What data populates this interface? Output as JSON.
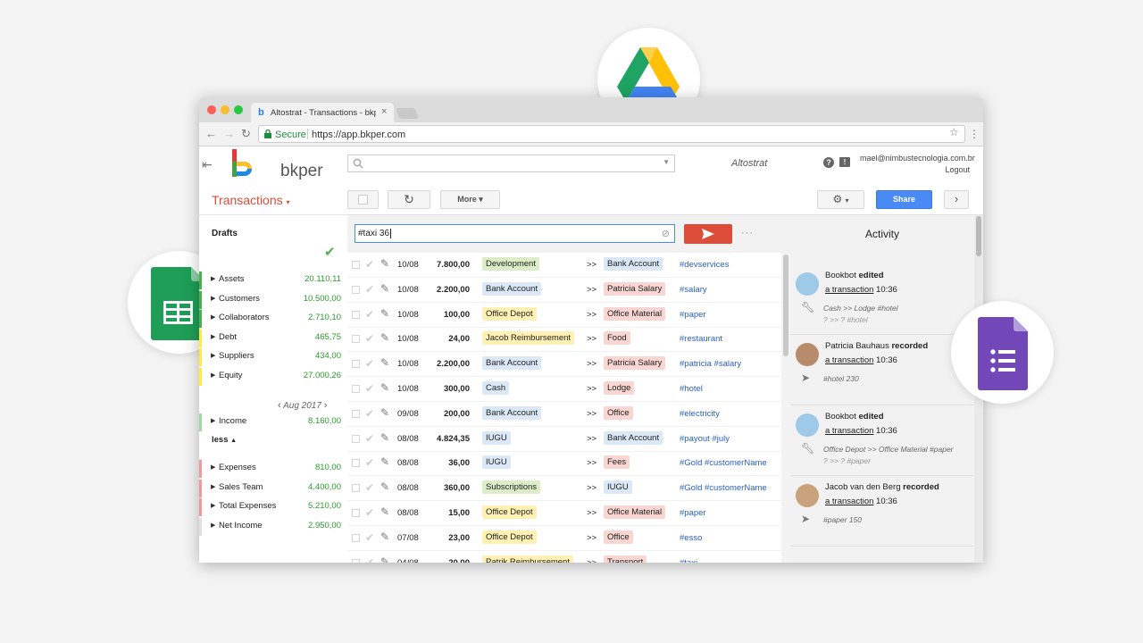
{
  "browser": {
    "tab_title": "Altostrat - Transactions - bkpe",
    "secure_label": "Secure",
    "url": "https://app.bkper.com"
  },
  "header": {
    "logo_text": "bkper",
    "book_name": "Altostrat",
    "user_email": "mael@nimbustecnologia.com.br",
    "logout": "Logout"
  },
  "toolbar": {
    "page_title": "Transactions",
    "more_label": "More",
    "share_label": "Share"
  },
  "sidebar": {
    "drafts_label": "Drafts",
    "groups_top": [
      {
        "label": "Assets",
        "value": "20.110,11",
        "color": "#4caf50"
      },
      {
        "label": "Customers",
        "value": "10.500,00",
        "color": "#4caf50"
      },
      {
        "label": "Collaborators",
        "value": "2.710,10",
        "color": "#4caf50"
      },
      {
        "label": "Debt",
        "value": "465,75",
        "color": "#ffeb3b"
      },
      {
        "label": "Suppliers",
        "value": "434,00",
        "color": "#ffeb3b"
      },
      {
        "label": "Equity",
        "value": "27.000,26",
        "color": "#ffeb3b"
      }
    ],
    "period": "Aug 2017",
    "income": {
      "label": "Income",
      "value": "8.160,00",
      "color": "#a5d6a7"
    },
    "less_label": "less",
    "groups_bottom": [
      {
        "label": "Expenses",
        "value": "810,00",
        "color": "#ef9a9a"
      },
      {
        "label": "Sales Team",
        "value": "4.400,00",
        "color": "#ef9a9a"
      },
      {
        "label": "Total Expenses",
        "value": "5.210,00",
        "color": "#ef9a9a"
      },
      {
        "label": "Net Income",
        "value": "2.950,00",
        "color": "#e0e0e0"
      }
    ]
  },
  "composer": {
    "input_value": "#taxi 36"
  },
  "transactions": [
    {
      "date": "10/08",
      "amount": "7.800,00",
      "from": "Development",
      "from_color": "#dcedc8",
      "to": "Bank Account",
      "to_color": "#dbe8f7",
      "desc": "#devservices"
    },
    {
      "date": "10/08",
      "amount": "2.200,00",
      "from": "Bank Account",
      "from_color": "#dbe8f7",
      "to": "Patricia Salary",
      "to_color": "#f9d6d2",
      "desc": "#salary"
    },
    {
      "date": "10/08",
      "amount": "100,00",
      "from": "Office Depot",
      "from_color": "#fff1b3",
      "to": "Office Material",
      "to_color": "#f9d6d2",
      "desc": "#paper"
    },
    {
      "date": "10/08",
      "amount": "24,00",
      "from": "Jacob Reimbursement",
      "from_color": "#fff1b3",
      "to": "Food",
      "to_color": "#f9d6d2",
      "desc": "#restaurant"
    },
    {
      "date": "10/08",
      "amount": "2.200,00",
      "from": "Bank Account",
      "from_color": "#dbe8f7",
      "to": "Patricia Salary",
      "to_color": "#f9d6d2",
      "desc": "#patricia #salary"
    },
    {
      "date": "10/08",
      "amount": "300,00",
      "from": "Cash",
      "from_color": "#dbe8f7",
      "to": "Lodge",
      "to_color": "#f9d6d2",
      "desc": "#hotel"
    },
    {
      "date": "09/08",
      "amount": "200,00",
      "from": "Bank Account",
      "from_color": "#dbe8f7",
      "to": "Office",
      "to_color": "#f9d6d2",
      "desc": "#electricity"
    },
    {
      "date": "08/08",
      "amount": "4.824,35",
      "from": "IUGU",
      "from_color": "#dbe8f7",
      "to": "Bank Account",
      "to_color": "#dbe8f7",
      "desc": "#payout #july"
    },
    {
      "date": "08/08",
      "amount": "36,00",
      "from": "IUGU",
      "from_color": "#dbe8f7",
      "to": "Fees",
      "to_color": "#f9d6d2",
      "desc": "#Gold #customerName"
    },
    {
      "date": "08/08",
      "amount": "360,00",
      "from": "Subscriptions",
      "from_color": "#dcedc8",
      "to": "IUGU",
      "to_color": "#dbe8f7",
      "desc": "#Gold #customerName"
    },
    {
      "date": "08/08",
      "amount": "15,00",
      "from": "Office Depot",
      "from_color": "#fff1b3",
      "to": "Office Material",
      "to_color": "#f9d6d2",
      "desc": "#paper"
    },
    {
      "date": "07/08",
      "amount": "23,00",
      "from": "Office Depot",
      "from_color": "#fff1b3",
      "to": "Office",
      "to_color": "#f9d6d2",
      "desc": "#esso"
    },
    {
      "date": "04/08",
      "amount": "20,00",
      "from": "Patrik Reimbursement",
      "from_color": "#fff1b3",
      "to": "Transport",
      "to_color": "#f9d6d2",
      "desc": "#taxi"
    }
  ],
  "activity": {
    "title": "Activity",
    "items": [
      {
        "actor": "Bookbot",
        "verb": "edited",
        "link": "a transaction",
        "time": "10:36",
        "icon": "wrench-icon",
        "line1": "Cash >> Lodge #hotel",
        "line2": "? >> ? #hotel"
      },
      {
        "actor": "Patricia Bauhaus",
        "verb": "recorded",
        "link": "a transaction",
        "time": "10:36",
        "icon": "send-icon",
        "line1": "#hotel 230",
        "line2": ""
      },
      {
        "actor": "Bookbot",
        "verb": "edited",
        "link": "a transaction",
        "time": "10:36",
        "icon": "wrench-icon",
        "line1": "Office Depot >> Office Material #paper",
        "line2": "? >> ? #paper"
      },
      {
        "actor": "Jacob van den Berg",
        "verb": "recorded",
        "link": "a transaction",
        "time": "10:36",
        "icon": "send-icon",
        "line1": "#paper 150",
        "line2": ""
      }
    ]
  }
}
